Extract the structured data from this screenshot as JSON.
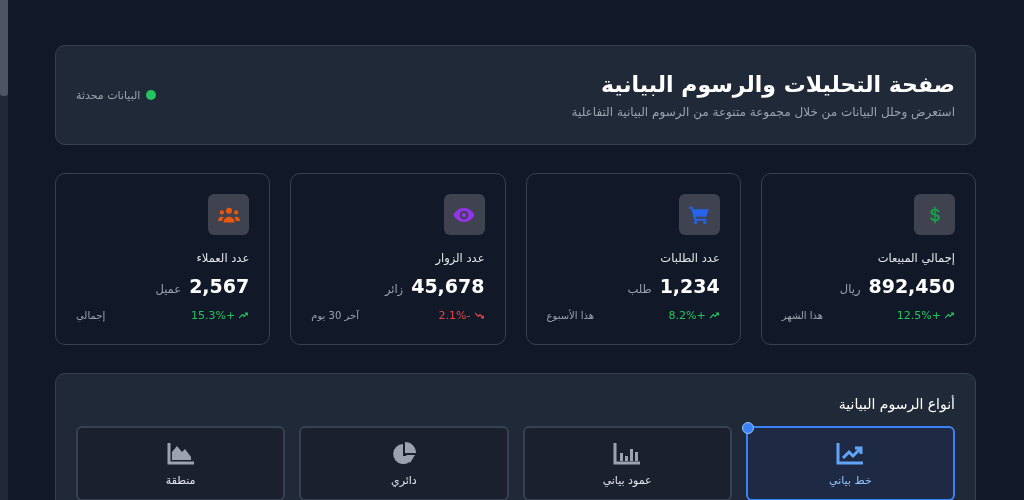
{
  "header": {
    "title": "صفحة التحليلات والرسوم البيانية",
    "subtitle": "استعرض وحلل البيانات من خلال مجموعة متنوعة من الرسوم البيانية التفاعلية",
    "status": {
      "label": "البيانات محدثة",
      "color": "#22c55e"
    }
  },
  "stats": [
    {
      "label": "إجمالي المبيعات",
      "value": "892,450",
      "unit": "ريال",
      "change": "12.5%+",
      "rising": true,
      "period": "هذا الشهر",
      "color": "#16a34a"
    },
    {
      "label": "عدد الطلبات",
      "value": "1,234",
      "unit": "طلب",
      "change": "8.2%+",
      "rising": true,
      "period": "هذا الأسبوع",
      "color": "#2563eb"
    },
    {
      "label": "عدد الزوار",
      "value": "45,678",
      "unit": "زائر",
      "change": "2.1%-",
      "rising": false,
      "period": "آخر 30 يوم",
      "color": "#9333ea"
    },
    {
      "label": "عدد العملاء",
      "value": "2,567",
      "unit": "عميل",
      "change": "15.3%+",
      "rising": true,
      "period": "إجمالي",
      "color": "#ea580c"
    }
  ],
  "chart_types": {
    "title": "أنواع الرسوم البيانية",
    "items": [
      {
        "label": "خط بياني",
        "selected": true
      },
      {
        "label": "عمود بياني",
        "selected": false
      },
      {
        "label": "دائري",
        "selected": false
      },
      {
        "label": "منطقة",
        "selected": false
      }
    ]
  }
}
